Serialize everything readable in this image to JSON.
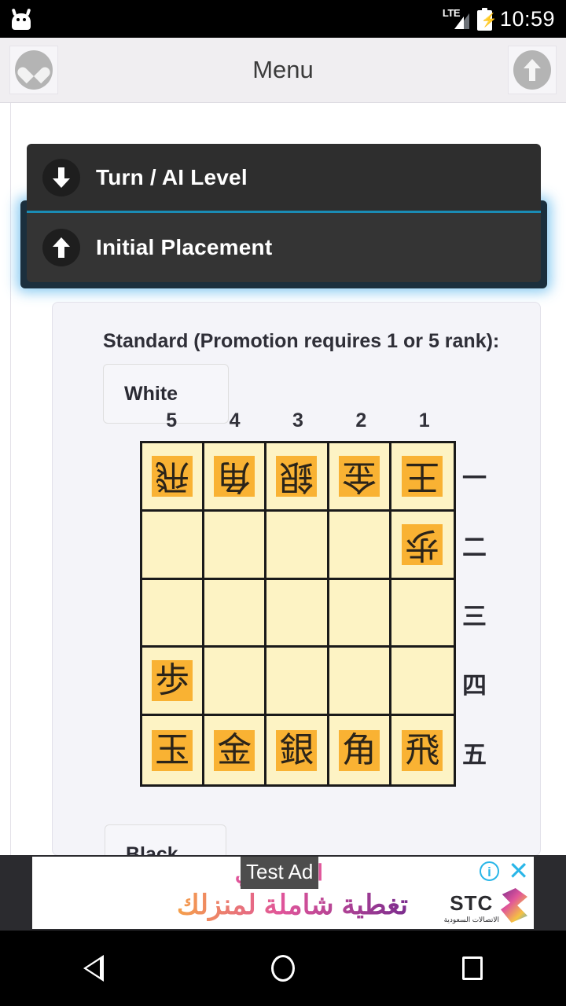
{
  "status_bar": {
    "notification_icon": "android-head-icon",
    "network": "LTE",
    "signal_icon": "signal-bars-icon",
    "battery_icon": "battery-charging-icon",
    "clock": "10:59"
  },
  "app_bar": {
    "left_button_icon": "heart-icon",
    "title": "Menu",
    "right_button_icon": "arrow-up-circle-icon"
  },
  "accordion": {
    "items": [
      {
        "label": "Turn / AI Level",
        "icon": "arrow-down-circle-icon",
        "expanded": false
      },
      {
        "label": "Initial Placement",
        "icon": "arrow-up-circle-icon",
        "expanded": true
      }
    ],
    "accent_color": "#1a8cb5",
    "glow_color": "#78c3f0"
  },
  "panel": {
    "title": "Standard (Promotion requires 1 or 5 rank):",
    "top_player_button": "White",
    "bottom_player_button": "Black",
    "radio_selected": true,
    "radio_color": "#2a7fc4"
  },
  "board": {
    "files": [
      "5",
      "4",
      "3",
      "2",
      "1"
    ],
    "ranks": [
      "一",
      "二",
      "三",
      "四",
      "五"
    ],
    "cell_color": "#fdf3c4",
    "piece_color": "#f9b233",
    "line_color": "#1a1a1a",
    "squares": [
      {
        "rank": "一",
        "file": "5",
        "piece": "飛",
        "owner": "white"
      },
      {
        "rank": "一",
        "file": "4",
        "piece": "角",
        "owner": "white"
      },
      {
        "rank": "一",
        "file": "3",
        "piece": "銀",
        "owner": "white"
      },
      {
        "rank": "一",
        "file": "2",
        "piece": "金",
        "owner": "white"
      },
      {
        "rank": "一",
        "file": "1",
        "piece": "王",
        "owner": "white"
      },
      {
        "rank": "二",
        "file": "5",
        "piece": "",
        "owner": ""
      },
      {
        "rank": "二",
        "file": "4",
        "piece": "",
        "owner": ""
      },
      {
        "rank": "二",
        "file": "3",
        "piece": "",
        "owner": ""
      },
      {
        "rank": "二",
        "file": "2",
        "piece": "",
        "owner": ""
      },
      {
        "rank": "二",
        "file": "1",
        "piece": "歩",
        "owner": "white"
      },
      {
        "rank": "三",
        "file": "5",
        "piece": "",
        "owner": ""
      },
      {
        "rank": "三",
        "file": "4",
        "piece": "",
        "owner": ""
      },
      {
        "rank": "三",
        "file": "3",
        "piece": "",
        "owner": ""
      },
      {
        "rank": "三",
        "file": "2",
        "piece": "",
        "owner": ""
      },
      {
        "rank": "三",
        "file": "1",
        "piece": "",
        "owner": ""
      },
      {
        "rank": "四",
        "file": "5",
        "piece": "歩",
        "owner": "black"
      },
      {
        "rank": "四",
        "file": "4",
        "piece": "",
        "owner": ""
      },
      {
        "rank": "四",
        "file": "3",
        "piece": "",
        "owner": ""
      },
      {
        "rank": "四",
        "file": "2",
        "piece": "",
        "owner": ""
      },
      {
        "rank": "四",
        "file": "1",
        "piece": "",
        "owner": ""
      },
      {
        "rank": "五",
        "file": "5",
        "piece": "玉",
        "owner": "black"
      },
      {
        "rank": "五",
        "file": "4",
        "piece": "金",
        "owner": "black"
      },
      {
        "rank": "五",
        "file": "3",
        "piece": "銀",
        "owner": "black"
      },
      {
        "rank": "五",
        "file": "2",
        "piece": "角",
        "owner": "black"
      },
      {
        "rank": "五",
        "file": "1",
        "piece": "飛",
        "owner": "black"
      }
    ]
  },
  "ad": {
    "test_label": "Test Ad",
    "line1": "الواي فاي",
    "line2": "تغطية شاملة لمنزلك",
    "brand": "STC",
    "brand_sub": "الاتصالات السعودية",
    "info_glyph": "i",
    "close_glyph": "✕",
    "control_color": "#29b6e8"
  },
  "nav_bar": {
    "back": "back-icon",
    "home": "home-icon",
    "recents": "recents-icon"
  }
}
